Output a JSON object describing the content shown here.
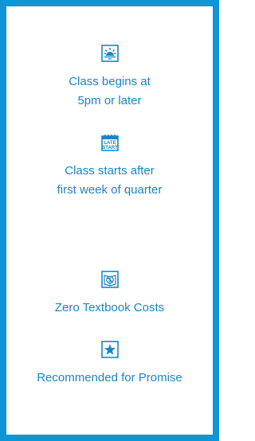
{
  "legend": {
    "items": [
      {
        "icon": "sunset-icon",
        "lines": [
          "Class begins at",
          "5pm or later"
        ]
      },
      {
        "icon": "late-start-calendar-icon",
        "icon_text": [
          "LATE",
          "START"
        ],
        "lines": [
          "Class starts after",
          "first week of quarter"
        ]
      },
      {
        "icon": "zero-textbook-cost-icon",
        "lines": [
          "Zero Textbook Costs"
        ]
      },
      {
        "icon": "star-icon",
        "lines": [
          "Recommended for Promise"
        ]
      }
    ]
  },
  "colors": {
    "frame": "#0f95d6",
    "accent": "#1a85c9",
    "background": "#ffffff"
  }
}
